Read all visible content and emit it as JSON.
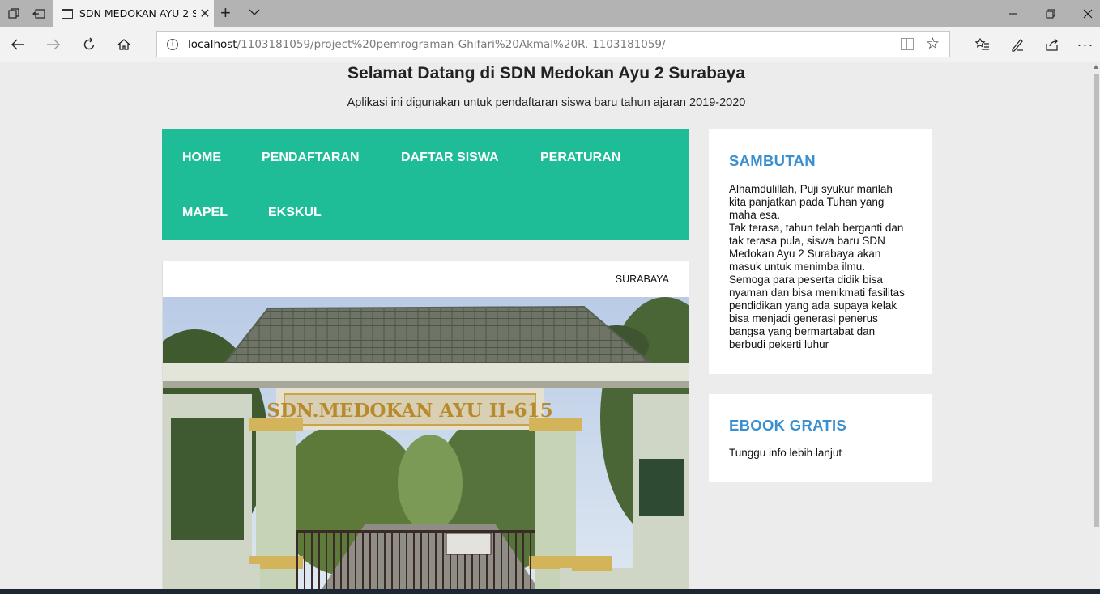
{
  "browser": {
    "tab_title": "SDN MEDOKAN AYU 2 S",
    "url_host": "localhost",
    "url_path": "/1103181059/project%20pemrograman-Ghifari%20Akmal%20R.-1103181059/"
  },
  "site": {
    "title": "Selamat Datang di SDN Medokan Ayu 2 Surabaya",
    "subtitle": "Aplikasi ini digunakan untuk pendaftaran siswa baru tahun ajaran 2019-2020"
  },
  "menu": {
    "items": [
      {
        "label": "HOME"
      },
      {
        "label": "PENDAFTARAN"
      },
      {
        "label": "DAFTAR SISWA"
      },
      {
        "label": "PERATURAN"
      },
      {
        "label": "MAPEL"
      },
      {
        "label": "EKSKUL"
      }
    ]
  },
  "content": {
    "location": "SURABAYA",
    "photo_sign": "SDN.MEDOKAN AYU II-615"
  },
  "sidebar": {
    "sambutan": {
      "title": "SAMBUTAN",
      "body": "Alhamdulillah, Puji syukur marilah kita panjatkan pada Tuhan yang maha esa.\nTak terasa, tahun telah berganti dan tak terasa pula, siswa baru SDN Medokan Ayu 2 Surabaya akan masuk untuk menimba ilmu.\nSemoga para peserta didik bisa nyaman dan bisa menikmati fasilitas pendidikan yang ada supaya kelak bisa menjadi generasi penerus bangsa yang bermartabat dan berbudi pekerti luhur"
    },
    "ebook": {
      "title": "EBOOK GRATIS",
      "body": "Tunggu info lebih lanjut"
    }
  }
}
